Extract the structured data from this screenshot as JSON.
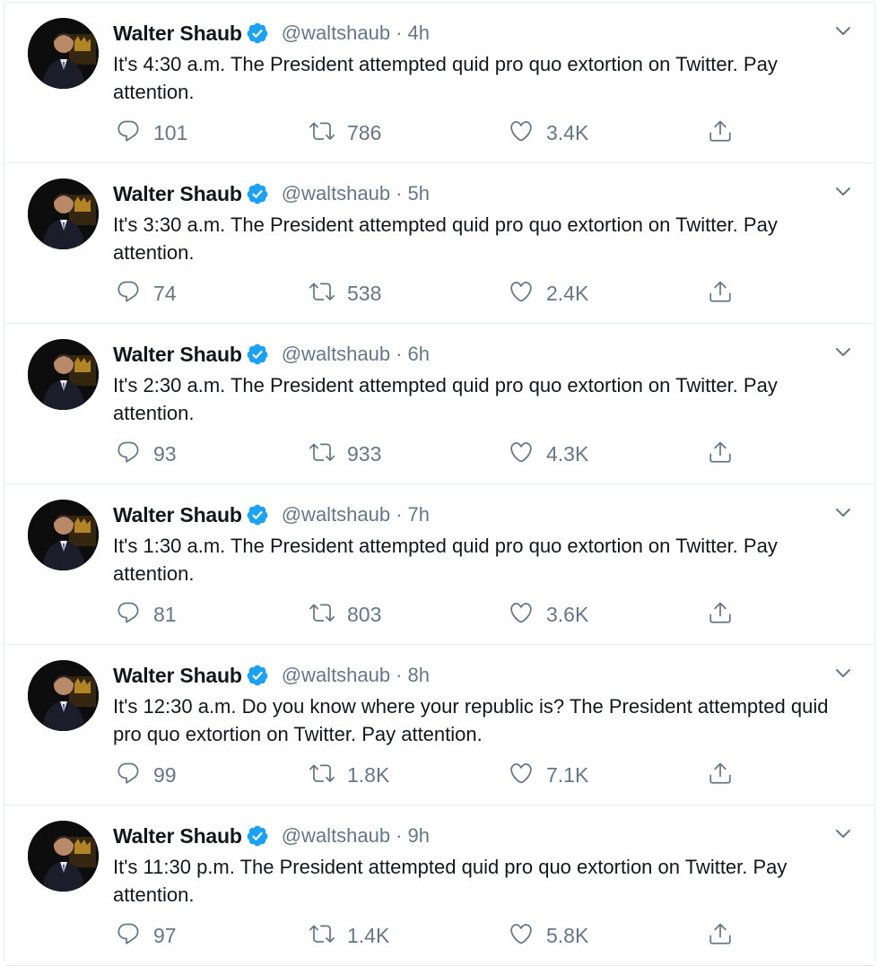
{
  "tweets": [
    {
      "name": "Walter Shaub",
      "handle": "@waltshaub",
      "separator": "·",
      "time": "4h",
      "text": "It's 4:30 a.m. The President attempted quid pro quo extortion on Twitter. Pay attention.",
      "replies": "101",
      "retweets": "786",
      "likes": "3.4K"
    },
    {
      "name": "Walter Shaub",
      "handle": "@waltshaub",
      "separator": "·",
      "time": "5h",
      "text": "It's 3:30 a.m. The President attempted quid pro quo extortion on Twitter. Pay attention.",
      "replies": "74",
      "retweets": "538",
      "likes": "2.4K"
    },
    {
      "name": "Walter Shaub",
      "handle": "@waltshaub",
      "separator": "·",
      "time": "6h",
      "text": "It's 2:30 a.m. The President attempted quid pro quo extortion on Twitter. Pay attention.",
      "replies": "93",
      "retweets": "933",
      "likes": "4.3K"
    },
    {
      "name": "Walter Shaub",
      "handle": "@waltshaub",
      "separator": "·",
      "time": "7h",
      "text": "It's 1:30 a.m. The President attempted quid pro quo extortion on Twitter. Pay attention.",
      "replies": "81",
      "retweets": "803",
      "likes": "3.6K"
    },
    {
      "name": "Walter Shaub",
      "handle": "@waltshaub",
      "separator": "·",
      "time": "8h",
      "text": "It's 12:30 a.m. Do you know where your republic is? The President attempted quid pro quo extortion on Twitter. Pay attention.",
      "replies": "99",
      "retweets": "1.8K",
      "likes": "7.1K"
    },
    {
      "name": "Walter Shaub",
      "handle": "@waltshaub",
      "separator": "·",
      "time": "9h",
      "text": "It's 11:30 p.m. The President attempted quid pro quo extortion on Twitter. Pay attention.",
      "replies": "97",
      "retweets": "1.4K",
      "likes": "5.8K"
    }
  ],
  "icons": {
    "verified": "verified-badge-icon",
    "caret": "chevron-down-icon",
    "reply": "reply-icon",
    "retweet": "retweet-icon",
    "like": "heart-icon",
    "share": "share-icon"
  },
  "colors": {
    "verified_blue": "#1da1f2",
    "secondary_text": "#657786",
    "border": "#e6ecf0",
    "primary_text": "#14171a"
  }
}
